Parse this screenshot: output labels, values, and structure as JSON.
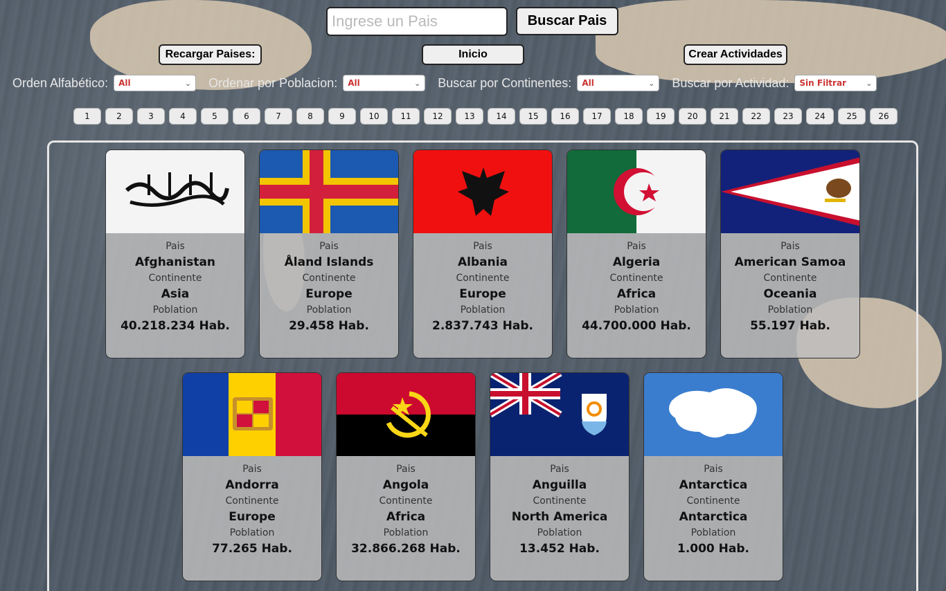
{
  "search": {
    "placeholder": "Ingrese un Pais",
    "button": "Buscar Pais"
  },
  "nav": {
    "reload": "Recargar Paises:",
    "home": "Inicio",
    "create": "Crear Actividades"
  },
  "filters": [
    {
      "label": "Orden Alfabético:",
      "value": "All"
    },
    {
      "label": "Ordenar por Poblacion:",
      "value": "All"
    },
    {
      "label": "Buscar por Continentes:",
      "value": "All"
    },
    {
      "label": "Buscar por Actividad:",
      "value": "Sin Filtrar"
    }
  ],
  "pagination": [
    "1",
    "2",
    "3",
    "4",
    "5",
    "6",
    "7",
    "8",
    "9",
    "10",
    "11",
    "12",
    "13",
    "14",
    "15",
    "16",
    "17",
    "18",
    "19",
    "20",
    "21",
    "22",
    "23",
    "24",
    "25",
    "26"
  ],
  "card_labels": {
    "country": "Pais",
    "continent": "Continente",
    "population": "Poblation"
  },
  "countries": [
    {
      "name": "Afghanistan",
      "continent": "Asia",
      "population": "40.218.234 Hab."
    },
    {
      "name": "Åland Islands",
      "continent": "Europe",
      "population": "29.458 Hab."
    },
    {
      "name": "Albania",
      "continent": "Europe",
      "population": "2.837.743 Hab."
    },
    {
      "name": "Algeria",
      "continent": "Africa",
      "population": "44.700.000 Hab."
    },
    {
      "name": "American Samoa",
      "continent": "Oceania",
      "population": "55.197 Hab."
    },
    {
      "name": "Andorra",
      "continent": "Europe",
      "population": "77.265 Hab."
    },
    {
      "name": "Angola",
      "continent": "Africa",
      "population": "32.866.268 Hab."
    },
    {
      "name": "Anguilla",
      "continent": "North America",
      "population": "13.452 Hab."
    },
    {
      "name": "Antarctica",
      "continent": "Antarctica",
      "population": "1.000 Hab."
    }
  ],
  "colors": {
    "select_text": "#cc3333",
    "card_bg": "#bebebe"
  }
}
